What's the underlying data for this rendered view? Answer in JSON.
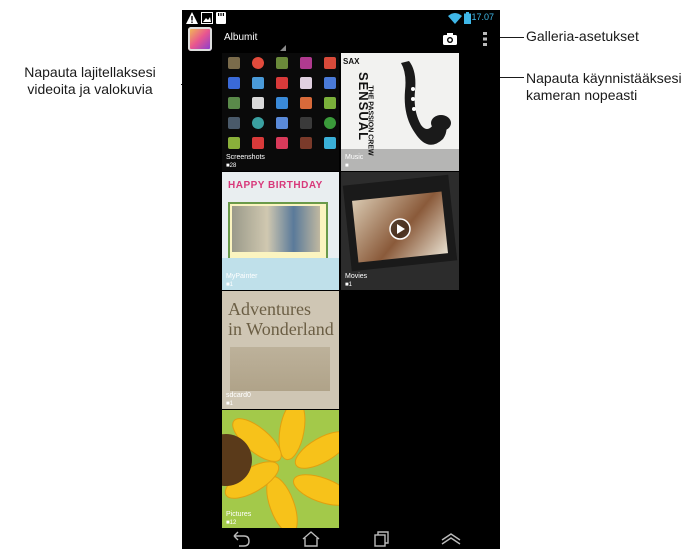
{
  "annotations": {
    "left": "Napauta lajitellaksesi videoita ja valokuvia",
    "right_top": "Galleria-asetukset",
    "right_bottom": "Napauta käynnistääksesi kameran nopeasti"
  },
  "statusbar": {
    "time": "17.07",
    "icons": [
      "warning-icon",
      "image-notification-icon",
      "storage-notification-icon",
      "wifi-icon",
      "battery-icon"
    ],
    "accent_color": "#3fb7e8"
  },
  "actionbar": {
    "album_label": "Albumit",
    "icons": [
      "gallery-app-icon",
      "camera-icon",
      "overflow-menu-icon"
    ]
  },
  "albums": [
    {
      "name": "Screenshots",
      "count": "28"
    },
    {
      "name": "Music",
      "count": ""
    },
    {
      "name": "MyPainter",
      "count": "1"
    },
    {
      "name": "Movies",
      "count": "1"
    },
    {
      "name": "sdcard0",
      "count": "1"
    },
    {
      "name": "Pictures",
      "count": "12"
    }
  ],
  "music_cover_text": [
    "SAX",
    "SENSUAL",
    "THE PASSION CREW"
  ],
  "sdcard_cover_text": [
    "Adventures",
    "in Wonderland"
  ],
  "mypainter_cover_text": "HAPPY BIRTHDAY",
  "navbar": {
    "icons": [
      "back-icon",
      "home-icon",
      "recent-apps-icon",
      "menu-up-icon"
    ]
  }
}
